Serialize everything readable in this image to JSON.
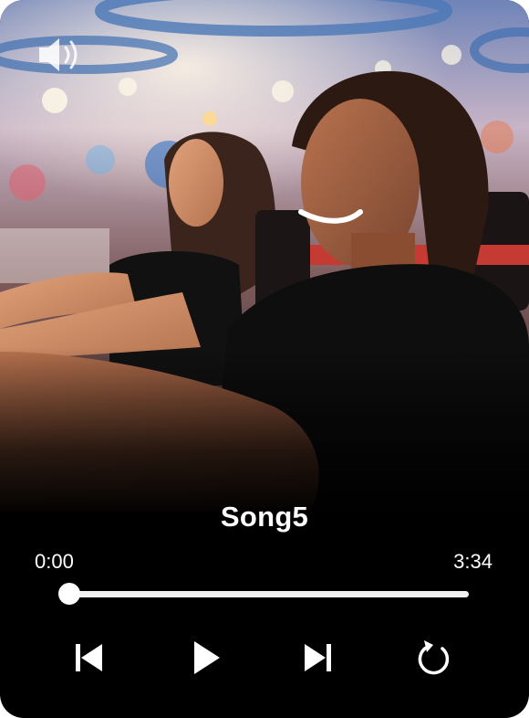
{
  "track": {
    "title": "Song5",
    "current_time": "0:00",
    "total_time": "3:34",
    "progress_fraction": 0
  },
  "controls": {
    "volume": "volume-icon",
    "previous": "skip-previous-icon",
    "play": "play-icon",
    "next": "skip-next-icon",
    "replay": "replay-icon"
  },
  "colors": {
    "background": "#000000",
    "text": "#ffffff",
    "track": "#f2f2f2"
  }
}
